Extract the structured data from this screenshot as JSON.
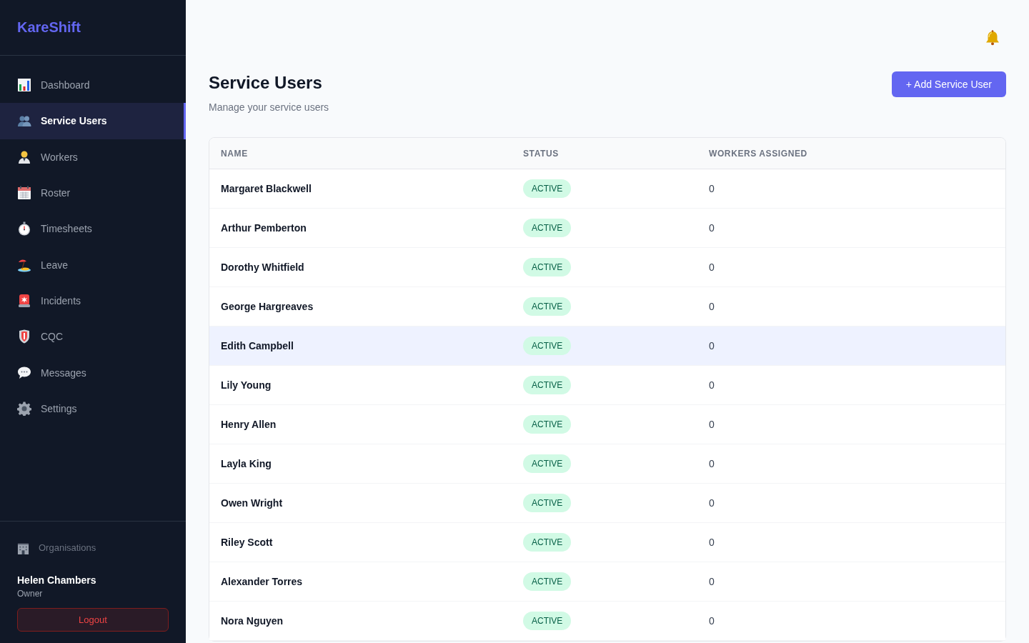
{
  "sidebar": {
    "logo": "KareShift",
    "items": [
      {
        "label": "Dashboard",
        "selected": false
      },
      {
        "label": "Service Users",
        "selected": true
      },
      {
        "label": "Workers",
        "selected": false
      },
      {
        "label": "Roster",
        "selected": false
      },
      {
        "label": "Timesheets",
        "selected": false
      },
      {
        "label": "Leave",
        "selected": false
      },
      {
        "label": "Incidents",
        "selected": false
      },
      {
        "label": "CQC",
        "selected": false
      },
      {
        "label": "Messages",
        "selected": false
      },
      {
        "label": "Settings",
        "selected": false
      }
    ],
    "organisations_link": "Organisations",
    "user": {
      "name": "Helen Chambers",
      "role": "Owner"
    },
    "logout_button": "Logout"
  },
  "header": {
    "title": "Service Users",
    "subtitle": "Manage your service users",
    "add_button": "+ Add Service User"
  },
  "table": {
    "columns": [
      "NAME",
      "STATUS",
      "WORKERS ASSIGNED"
    ],
    "rows": [
      {
        "name": "Margaret Blackwell",
        "status": "ACTIVE",
        "workers_assigned": "0",
        "highlighted": false
      },
      {
        "name": "Arthur Pemberton",
        "status": "ACTIVE",
        "workers_assigned": "0",
        "highlighted": false
      },
      {
        "name": "Dorothy Whitfield",
        "status": "ACTIVE",
        "workers_assigned": "0",
        "highlighted": false
      },
      {
        "name": "George Hargreaves",
        "status": "ACTIVE",
        "workers_assigned": "0",
        "highlighted": false
      },
      {
        "name": "Edith Campbell",
        "status": "ACTIVE",
        "workers_assigned": "0",
        "highlighted": true
      },
      {
        "name": "Lily Young",
        "status": "ACTIVE",
        "workers_assigned": "0",
        "highlighted": false
      },
      {
        "name": "Henry Allen",
        "status": "ACTIVE",
        "workers_assigned": "0",
        "highlighted": false
      },
      {
        "name": "Layla King",
        "status": "ACTIVE",
        "workers_assigned": "0",
        "highlighted": false
      },
      {
        "name": "Owen Wright",
        "status": "ACTIVE",
        "workers_assigned": "0",
        "highlighted": false
      },
      {
        "name": "Riley Scott",
        "status": "ACTIVE",
        "workers_assigned": "0",
        "highlighted": false
      },
      {
        "name": "Alexander Torres",
        "status": "ACTIVE",
        "workers_assigned": "0",
        "highlighted": false
      },
      {
        "name": "Nora Nguyen",
        "status": "ACTIVE",
        "workers_assigned": "0",
        "highlighted": false
      }
    ]
  }
}
